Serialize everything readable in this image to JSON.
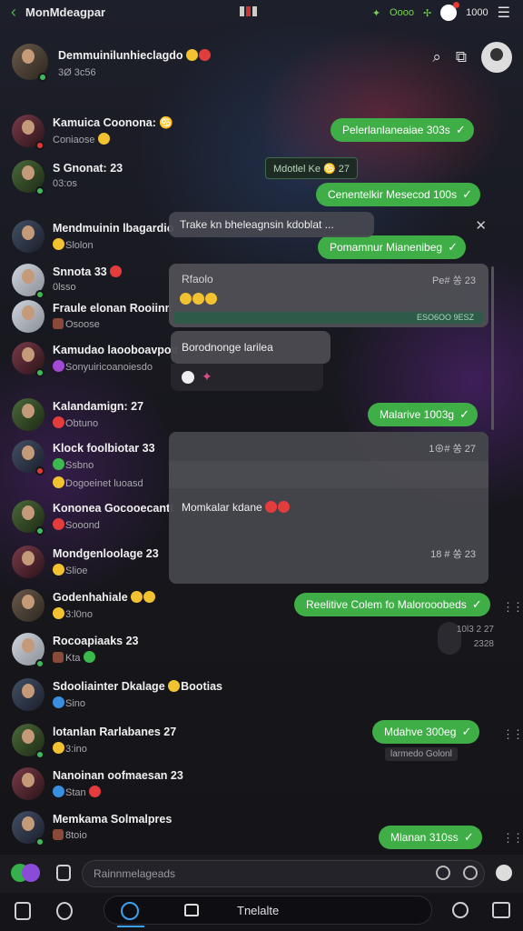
{
  "status": {
    "title": "MonMdeagpar",
    "coins": "Oooo",
    "count": "1000"
  },
  "header": {
    "top_chat_name": "Demmuinilunhieclagdo",
    "top_chat_sub": "3Ø 3c56"
  },
  "chats": [
    {
      "name": "Kamuica Coonona: ♋",
      "sub": "Coniaose"
    },
    {
      "name": "S Gnonat: 23",
      "sub": "03:os"
    },
    {
      "name": "Mendmuinin lbagardio",
      "sub": "Slolon"
    },
    {
      "name": "Snnota 33",
      "sub": "0lsso"
    },
    {
      "name": "Fraule elonan Rooiinn",
      "sub": "Osoose"
    },
    {
      "name": "Kamudao laooboavpoit",
      "sub": "Sonyuiricoanoiesdo"
    },
    {
      "name": "Kalandamign: 27",
      "sub": "Obtuno"
    },
    {
      "name": "Klock foolbiotar 33",
      "sub": "Ssbno"
    },
    {
      "name": "Kononea Gocooecantt",
      "sub": "Sooond"
    },
    {
      "name": "Mondgenloolage 23",
      "sub": "Slioe"
    },
    {
      "name": "Godenhahiale",
      "sub": "3:l0no"
    },
    {
      "name": "Rocoapiaaks 23",
      "sub": "Kta"
    },
    {
      "name": "Sdooliainter Dkalage",
      "sub": "Sino"
    },
    {
      "name": "lotanlan Rarlabanes 27",
      "sub": "3:ino"
    },
    {
      "name": "Nanoinan oofmaesan 23",
      "sub": "Stan"
    },
    {
      "name": "Memkama Solmalpres",
      "sub": "8toio"
    }
  ],
  "extra_labels": {
    "dogemin": "Dogoeinet luoasd",
    "boctias": "Bootias"
  },
  "messages": {
    "m1": "Pelerlanlaneaiae 303s",
    "sys": "Mdotlel Ke ♋ 27",
    "m2": "Cenentelkir Mesecod 100s",
    "m3": "Pomamnur Mianenibeg",
    "m4": "Malarive 1003g",
    "m5": "Reelitive Colem fo Malorooobeds",
    "m6": "Mdahve 300eg",
    "m6_caption": "larmedo Golonl",
    "m7": "Mlanan 310ss",
    "time_a": "10l3 2 27",
    "time_b": "2328"
  },
  "overlay": {
    "header": "Trake kn bheleagnsin kdoblat ...",
    "card1_label": "Rfaolo",
    "card1_time": "Pe# 쏭 23",
    "card1_strip": "ESO6OO 9ESZ",
    "card2_text": "Borodnonge larilea",
    "card3_time_top": "1⊕# 쏭 27",
    "card3_text": "Momkalar kdane",
    "card3_time_bottom": "18 # 쏭 23"
  },
  "composer": {
    "placeholder": "Rainnmelageads"
  },
  "bottom_nav": {
    "label": "Tnelalte"
  }
}
